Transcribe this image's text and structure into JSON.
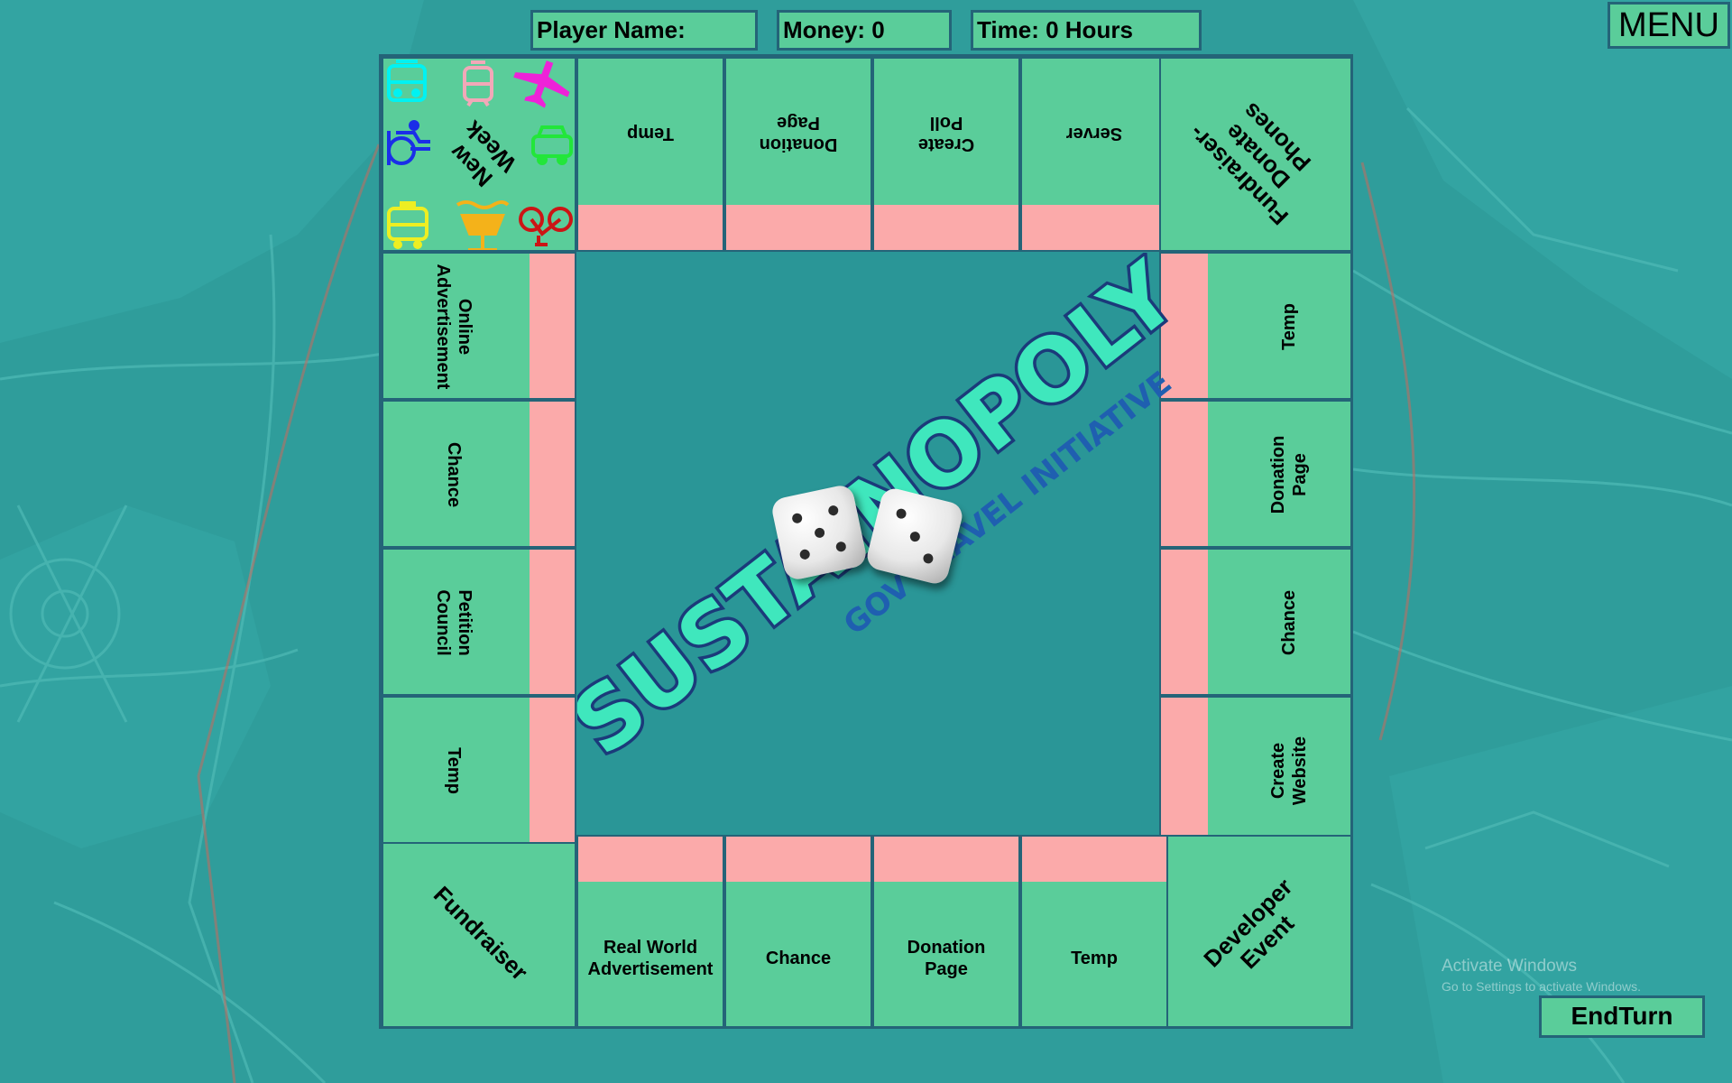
{
  "hud": {
    "player_name": "Player Name:",
    "money": "Money: 0",
    "time": "Time: 0 Hours"
  },
  "menu_label": "MENU",
  "end_turn_label": "EndTurn",
  "watermark": {
    "line1": "Activate Windows",
    "line2": "Go to Settings to activate Windows."
  },
  "logo": {
    "title": "SUSTAINOPOLY",
    "subtitle": "GOV TRAVEL INITIATIVE"
  },
  "tiles": {
    "corner_top_left": "New Week",
    "top": [
      "Temp",
      "Donation Page",
      "Create Poll",
      "Server"
    ],
    "corner_top_right": "Fundraiser- Donate Phones",
    "right": [
      "Temp",
      "Donation Page",
      "Chance",
      "Create Website"
    ],
    "corner_bottom_right": "Developer Event",
    "bottom": [
      "Real World Advertisement",
      "Chance",
      "Donation Page",
      "Temp"
    ],
    "corner_bottom_left": "Fundraiser",
    "left": [
      "Online Advertisement",
      "Chance",
      "Petition Council",
      "Temp"
    ]
  },
  "tokens": [
    {
      "icon": "bus-icon",
      "color": "#00f2f2"
    },
    {
      "icon": "tram-icon",
      "color": "#f2a8b8"
    },
    {
      "icon": "plane-icon",
      "color": "#ee22d8"
    },
    {
      "icon": "wheelchair-icon",
      "color": "#1a2ee8"
    },
    {
      "icon": "car-icon",
      "color": "#22e63a"
    },
    {
      "icon": "taxi-icon",
      "color": "#eeee22"
    },
    {
      "icon": "boat-icon",
      "color": "#f4b21a"
    },
    {
      "icon": "bicycle-icon",
      "color": "#cc1515"
    }
  ],
  "dice": [
    5,
    3
  ],
  "colors": {
    "tile": "#5acd9a",
    "strip": "#fbaaaa",
    "border": "#246478",
    "board": "#2a9697",
    "background": "#2f9d9b"
  }
}
